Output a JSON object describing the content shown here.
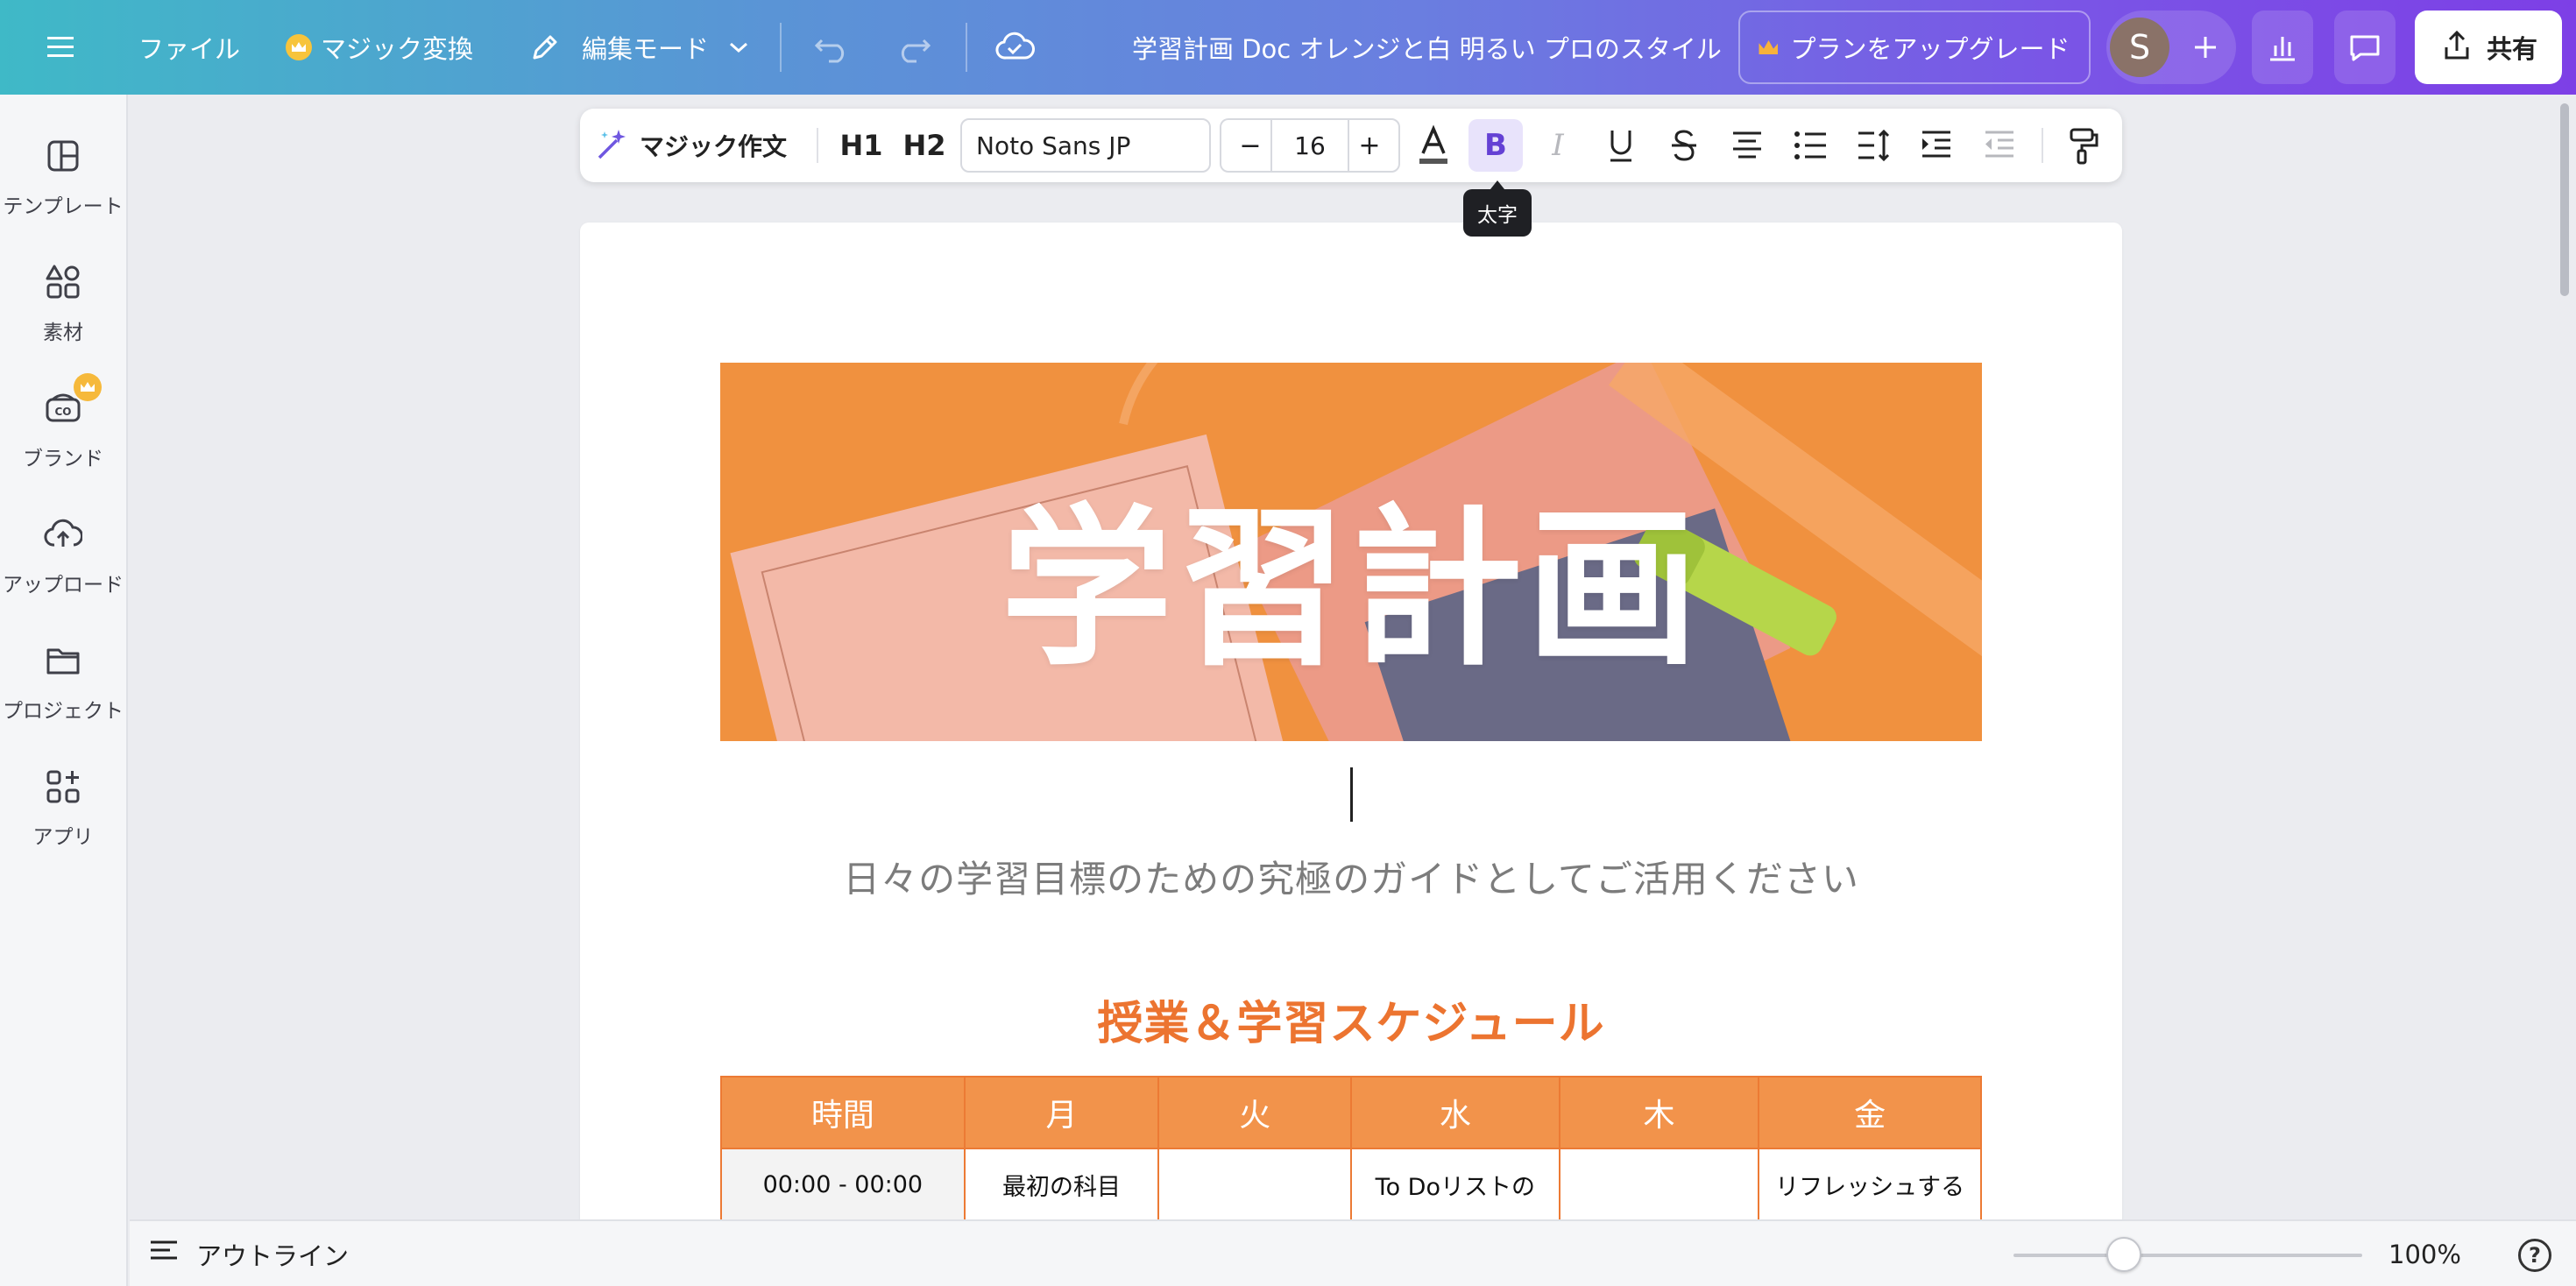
{
  "topbar": {
    "file_label": "ファイル",
    "magic_switch_label": "マジック変換",
    "edit_mode_label": "編集モード",
    "doc_title": "学習計画 Doc オレンジと白 明るい プロのスタイル",
    "upgrade_label": "プランをアップグレード",
    "avatar_initial": "S",
    "share_label": "共有"
  },
  "sidebar": {
    "items": [
      {
        "label": "テンプレート",
        "icon": "template-icon"
      },
      {
        "label": "素材",
        "icon": "elements-icon"
      },
      {
        "label": "ブランド",
        "icon": "brand-icon"
      },
      {
        "label": "アップロード",
        "icon": "upload-icon"
      },
      {
        "label": "プロジェクト",
        "icon": "folder-icon"
      },
      {
        "label": "アプリ",
        "icon": "apps-icon"
      }
    ]
  },
  "toolbar": {
    "magic_write_label": "マジック作文",
    "h1_label": "H1",
    "h2_label": "H2",
    "font_name": "Noto Sans JP",
    "font_size": "16",
    "minus": "−",
    "plus": "+",
    "bold_tooltip": "太字"
  },
  "document": {
    "banner_title": "学習計画",
    "subtitle": "日々の学習目標のための究極のガイドとしてご活用ください",
    "section_heading": "授業＆学習スケジュール",
    "schedule": {
      "headers": [
        "時間",
        "月",
        "火",
        "水",
        "木",
        "金"
      ],
      "rows": [
        [
          "00:00 - 00:00",
          "最初の科目",
          "",
          "To Doリストの",
          "",
          "リフレッシュする"
        ]
      ]
    }
  },
  "bottombar": {
    "outline_label": "アウトライン",
    "zoom_label": "100%",
    "zoom_value": 100,
    "help_label": "?"
  },
  "colors": {
    "accent_orange": "#ec7430",
    "table_header": "#f2934b",
    "active_bold_bg": "#e8e3fb",
    "active_bold_fg": "#6441d4"
  }
}
